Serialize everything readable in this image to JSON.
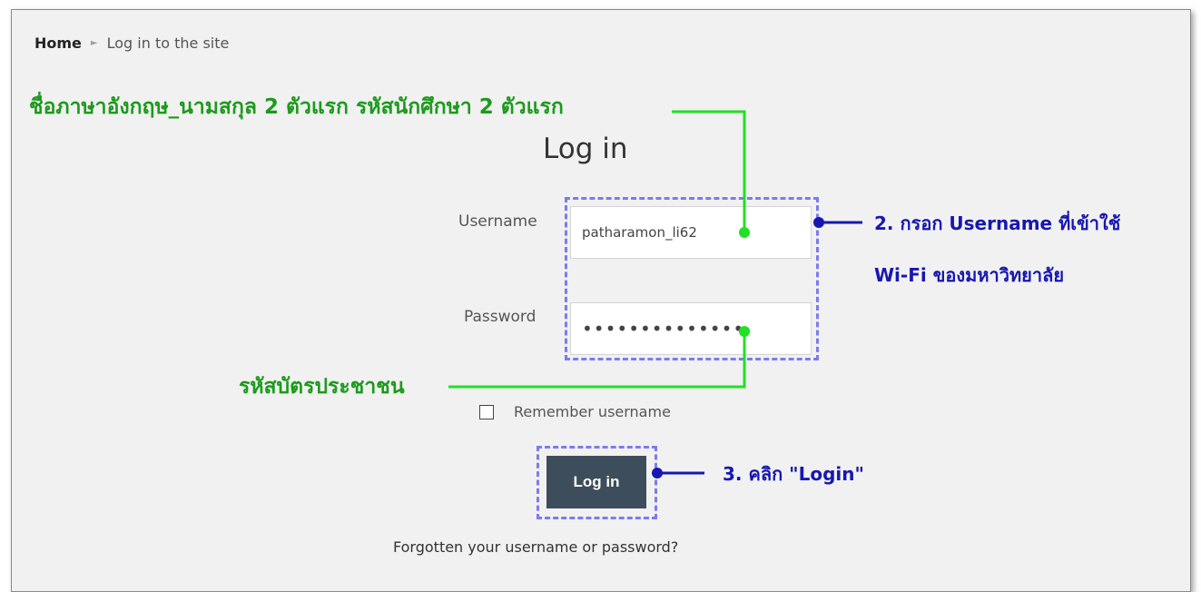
{
  "breadcrumb": {
    "home": "Home",
    "current": "Log in to the site"
  },
  "login": {
    "title": "Log in",
    "username_label": "Username",
    "username_value": "patharamon_li62",
    "password_label": "Password",
    "password_value": "••••••••••••••",
    "remember_label": "Remember username",
    "button_label": "Log in",
    "forgot_link": "Forgotten your username or password?"
  },
  "annotations": {
    "username_hint": "ชื่อภาษาอังกฤษ_นามสกุล 2 ตัวแรก รหัสนักศึกษา 2 ตัวแรก",
    "password_hint": "รหัสบัตรประชาชน",
    "step2_line1": "2. กรอก Username ที่เข้าใช้",
    "step2_line2": "Wi-Fi ของมหาวิทยาลัย",
    "step3": "3. คลิก \"Login\""
  },
  "colors": {
    "annotation_green": "#1d9a1d",
    "connector_green": "#22e022",
    "annotation_blue": "#1717b0",
    "dash_box": "#7b7bf0",
    "button_bg": "#3e4d5b"
  }
}
